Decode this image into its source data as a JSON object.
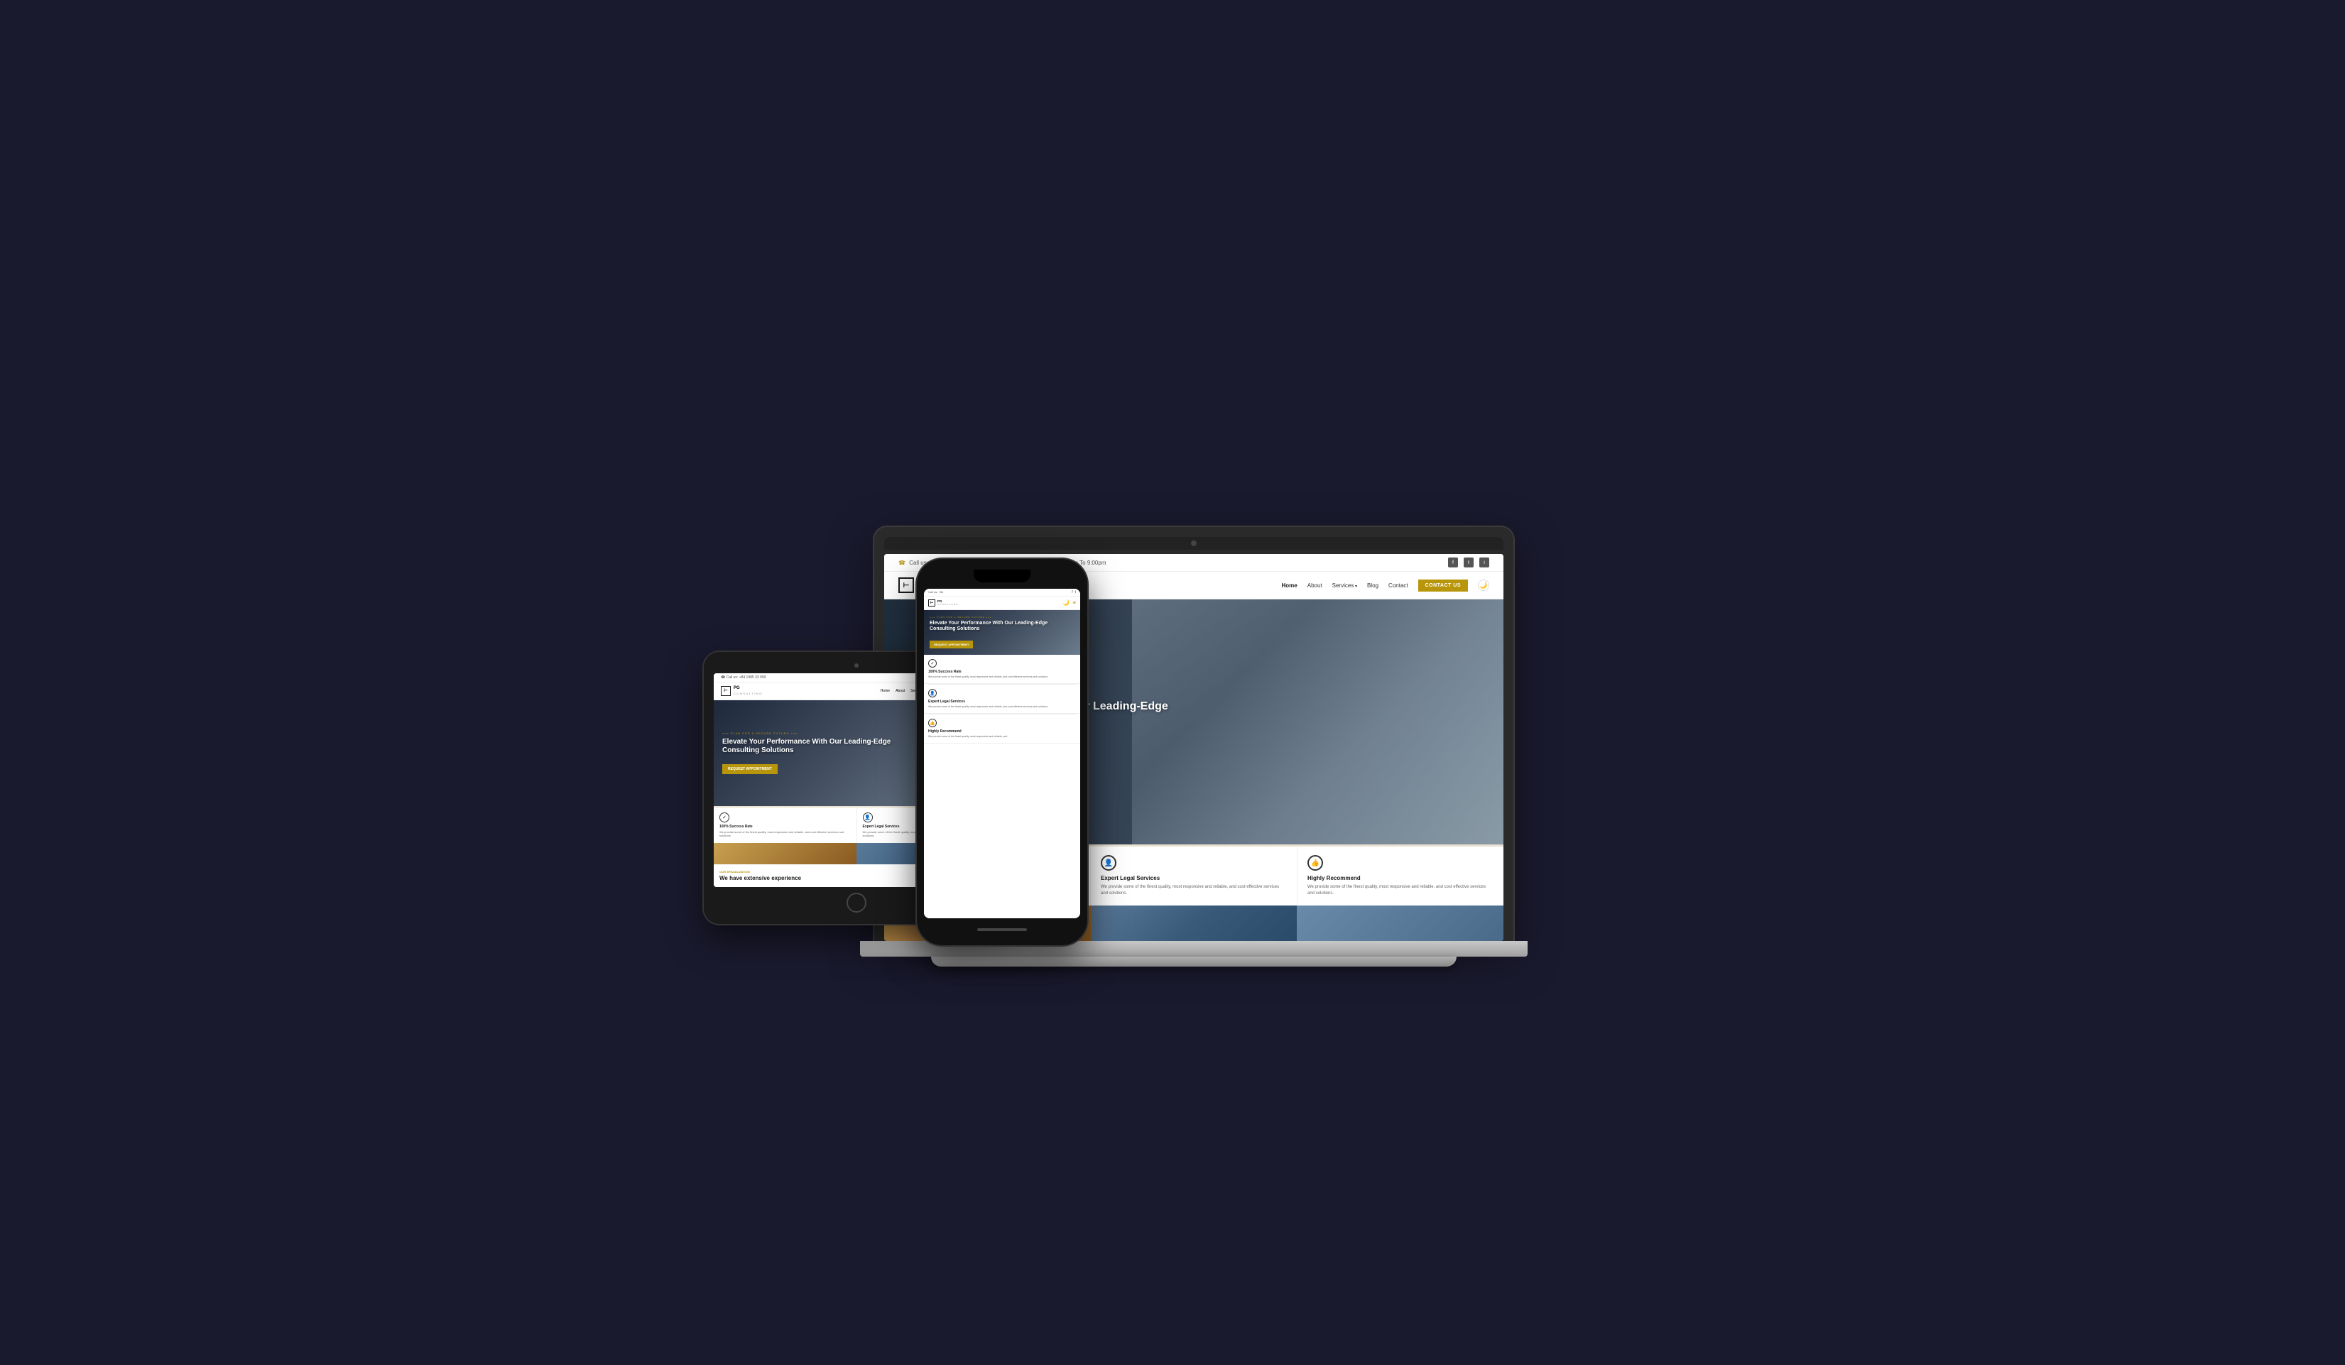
{
  "brand": {
    "name": "PG",
    "sub": "CONSULTING",
    "logoSymbol": "⊢"
  },
  "topBar": {
    "phone": "Call us: +84 1985 33 999",
    "hours": "Opening hours: Mon - Sat: 8:00am To 9:00pm",
    "phoneIcon": "☎",
    "clockIcon": "⊙"
  },
  "nav": {
    "home": "Home",
    "about": "About",
    "services": "Services",
    "blog": "Blog",
    "contact": "Contact",
    "contactBtn": "CONTACT US",
    "darkToggle": "🌙"
  },
  "hero": {
    "tag": "PLAN FOR A SECURE FUTURE",
    "title": "Elevate Your Performance With Our Leading-Edge Consulting Solutions",
    "cta": "REQUEST APPOINTMENT"
  },
  "features": [
    {
      "icon": "✓",
      "title": "100% Success Rate",
      "desc": "We provide some of the finest quality, most responsive and reliable, and cost effective services and solutions."
    },
    {
      "icon": "👤",
      "title": "Expert Legal Services",
      "desc": "We provide some of the finest quality, most responsive and reliable, and cost effective services and solutions."
    },
    {
      "icon": "👍",
      "title": "Highly Recommend",
      "desc": "We provide some of the finest quality, most responsive and reliable, and cost effective services and solutions."
    }
  ],
  "specialization": {
    "tag": "OUR SPEZIALIZATION",
    "title": "We have extensive experience"
  },
  "social": {
    "facebook": "f",
    "twitter": "t",
    "instagram": "i"
  }
}
